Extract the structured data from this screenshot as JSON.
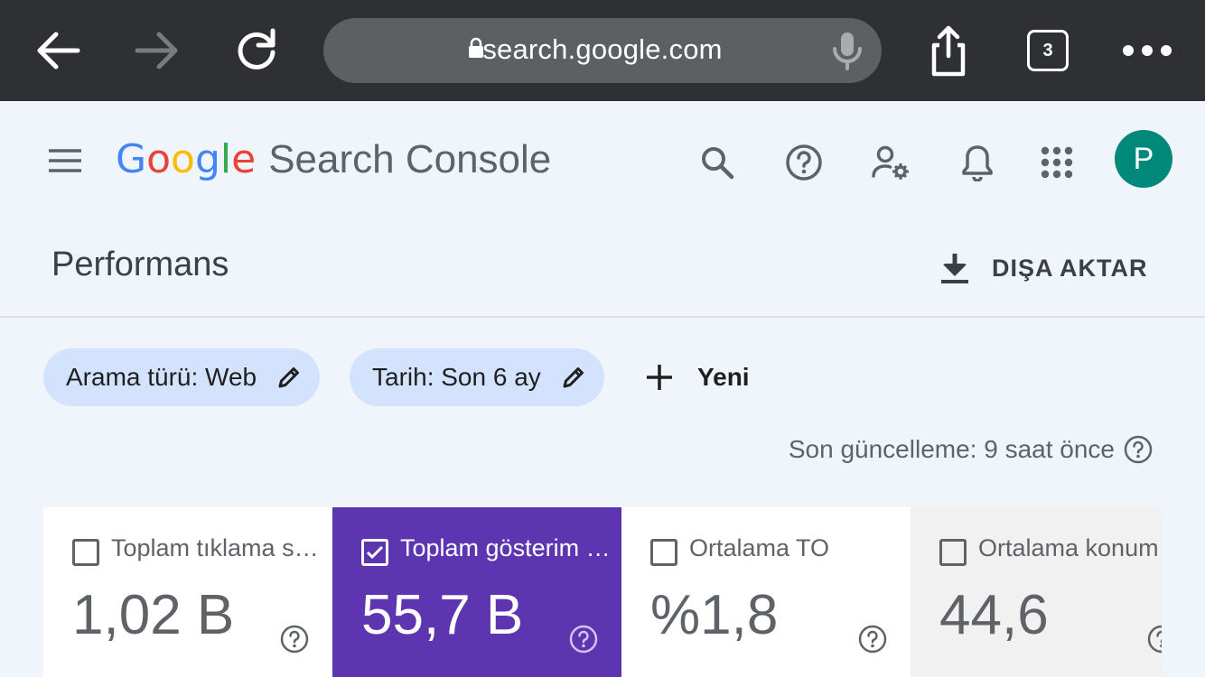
{
  "browser": {
    "url": "search.google.com",
    "tab_count": "3"
  },
  "app": {
    "logo_letters": [
      {
        "ch": "G",
        "color": "#4285F4"
      },
      {
        "ch": "o",
        "color": "#EA4335"
      },
      {
        "ch": "o",
        "color": "#FBBC05"
      },
      {
        "ch": "g",
        "color": "#4285F4"
      },
      {
        "ch": "l",
        "color": "#34A853"
      },
      {
        "ch": "e",
        "color": "#EA4335"
      }
    ],
    "product_name": "Search Console",
    "avatar_initial": "P",
    "avatar_color": "#00897b"
  },
  "page": {
    "title": "Performans",
    "export_label": "DIŞA AKTAR"
  },
  "filters": {
    "chips": [
      {
        "label": "Arama türü: Web"
      },
      {
        "label": "Tarih: Son 6 ay"
      }
    ],
    "new_label": "Yeni"
  },
  "last_updated": "Son güncelleme: 9 saat önce",
  "metrics": [
    {
      "label": "Toplam tıklama sayısı",
      "value": "1,02 B",
      "checked": false
    },
    {
      "label": "Toplam gösterim sayısı",
      "value": "55,7 B",
      "checked": true
    },
    {
      "label": "Ortalama TO",
      "value": "%1,8",
      "checked": false
    },
    {
      "label": "Ortalama konum",
      "value": "44,6",
      "checked": false
    }
  ],
  "colors": {
    "selected_card": "#5e35b1",
    "chip_bg": "#d3e3fd",
    "browser_bar": "#2f3033"
  }
}
